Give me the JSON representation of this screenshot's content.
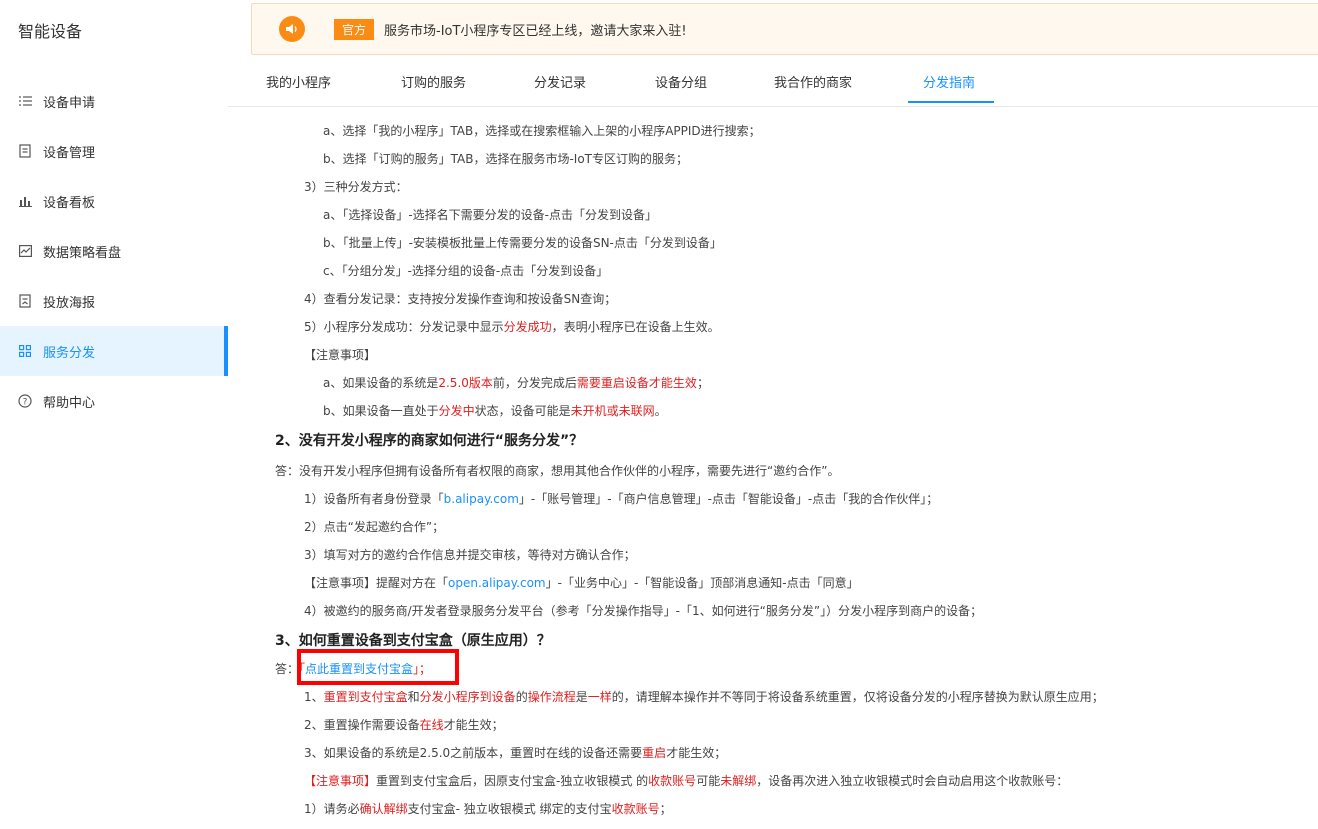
{
  "sidebar": {
    "title": "智能设备",
    "items": [
      {
        "label": "设备申请",
        "icon": "list-icon"
      },
      {
        "label": "设备管理",
        "icon": "document-icon"
      },
      {
        "label": "设备看板",
        "icon": "bar-chart-icon"
      },
      {
        "label": "数据策略看盘",
        "icon": "line-chart-icon"
      },
      {
        "label": "投放海报",
        "icon": "poster-icon"
      },
      {
        "label": "服务分发",
        "icon": "grid-icon",
        "active": true
      },
      {
        "label": "帮助中心",
        "icon": "help-icon"
      }
    ]
  },
  "notice": {
    "tag": "官方",
    "text": "服务市场-IoT小程序专区已经上线，邀请大家来入驻!"
  },
  "tabs": [
    "我的小程序",
    "订购的服务",
    "分发记录",
    "设备分组",
    "我合作的商家",
    "分发指南"
  ],
  "active_tab": "分发指南",
  "content": {
    "l1": "a、选择「我的小程序」TAB，选择或在搜索框输入上架的小程序APPID进行搜索；",
    "l2": "b、选择「订购的服务」TAB，选择在服务市场-IoT专区订购的服务；",
    "l3": "3）三种分发方式：",
    "l4": "a、「选择设备」-选择名下需要分发的设备-点击「分发到设备」",
    "l5": "b、「批量上传」-安装模板批量上传需要分发的设备SN-点击「分发到设备」",
    "l6": "c、「分组分发」-选择分组的设备-点击「分发到设备」",
    "l7": "4）查看分发记录：支持按分发操作查询和按设备SN查询；",
    "l8a": "5）小程序分发成功：分发记录中显示",
    "l8b": "分发成功",
    "l8c": "，表明小程序已在设备上生效。",
    "l9": "【注意事项】",
    "l10a": "a、如果设备的系统是",
    "l10b": "2.5.0版本",
    "l10c": "前，分发完成后",
    "l10d": "需要重启设备才能生效",
    "l10e": "；",
    "l11a": "b、如果设备一直处于",
    "l11b": "分发中",
    "l11c": "状态，设备可能是",
    "l11d": "未开机或未联网",
    "l11e": "。",
    "h2": "2、没有开发小程序的商家如何进行“服务分发”？",
    "a2": "答：没有开发小程序但拥有设备所有者权限的商家，想用其他合作伙伴的小程序，需要先进行“邀约合作”。",
    "s1a": "1）设备所有者身份登录「",
    "s1link": "b.alipay.com",
    "s1b": "」-「账号管理」-「商户信息管理」-点击「智能设备」-点击「我的合作伙伴」；",
    "s2": "2）点击“发起邀约合作”；",
    "s3": "3）填写对方的邀约合作信息并提交审核，等待对方确认合作；",
    "s4a": "【注意事项】提醒对方在「",
    "s4link": "open.alipay.com",
    "s4b": "」-「业务中心」-「智能设备」顶部消息通知-点击「同意」",
    "s5": "4）被邀约的服务商/开发者登录服务分发平台（参考「分发操作指导」-「1、如何进行“服务分发”」）分发小程序到商户的设备；",
    "h3": "3、如何重置设备到支付宝盒（原生应用）？",
    "a3pre": "答：",
    "a3open": "「",
    "a3link": "点此重置到支付宝盒",
    "a3close": "」；",
    "r1a": "1、",
    "r1b": "重置到支付宝盒",
    "r1c": "和",
    "r1d": "分发小程序到设备",
    "r1e": "的",
    "r1f": "操作流程",
    "r1g": "是",
    "r1h": "一样",
    "r1i": "的，请理解本操作并不等同于将设备系统重置，仅将设备分发的小程序替换为默认原生应用；",
    "r2a": "2、重置操作需要设备",
    "r2b": "在线",
    "r2c": "才能生效；",
    "r3a": "3、如果设备的系统是2.5.0之前版本，重置时在线的设备还需要",
    "r3b": "重启",
    "r3c": "才能生效；",
    "r4a": "【注意事项】",
    "r4b": "重置到支付宝盒后，因原支付宝盒-独立收银模式 的",
    "r4c": "收款账号",
    "r4d": "可能",
    "r4e": "未解绑",
    "r4f": "，设备再次进入独立收银模式时会自动启用这个收款账号：",
    "r5a": "1）请务必",
    "r5b": "确认解绑",
    "r5c": "支付宝盒- 独立收银模式 绑定的支付宝",
    "r5d": "收款账号",
    "r5e": "；"
  },
  "colors": {
    "accent": "#1890ff",
    "warning": "#fa8c16",
    "red": "#e02020"
  }
}
